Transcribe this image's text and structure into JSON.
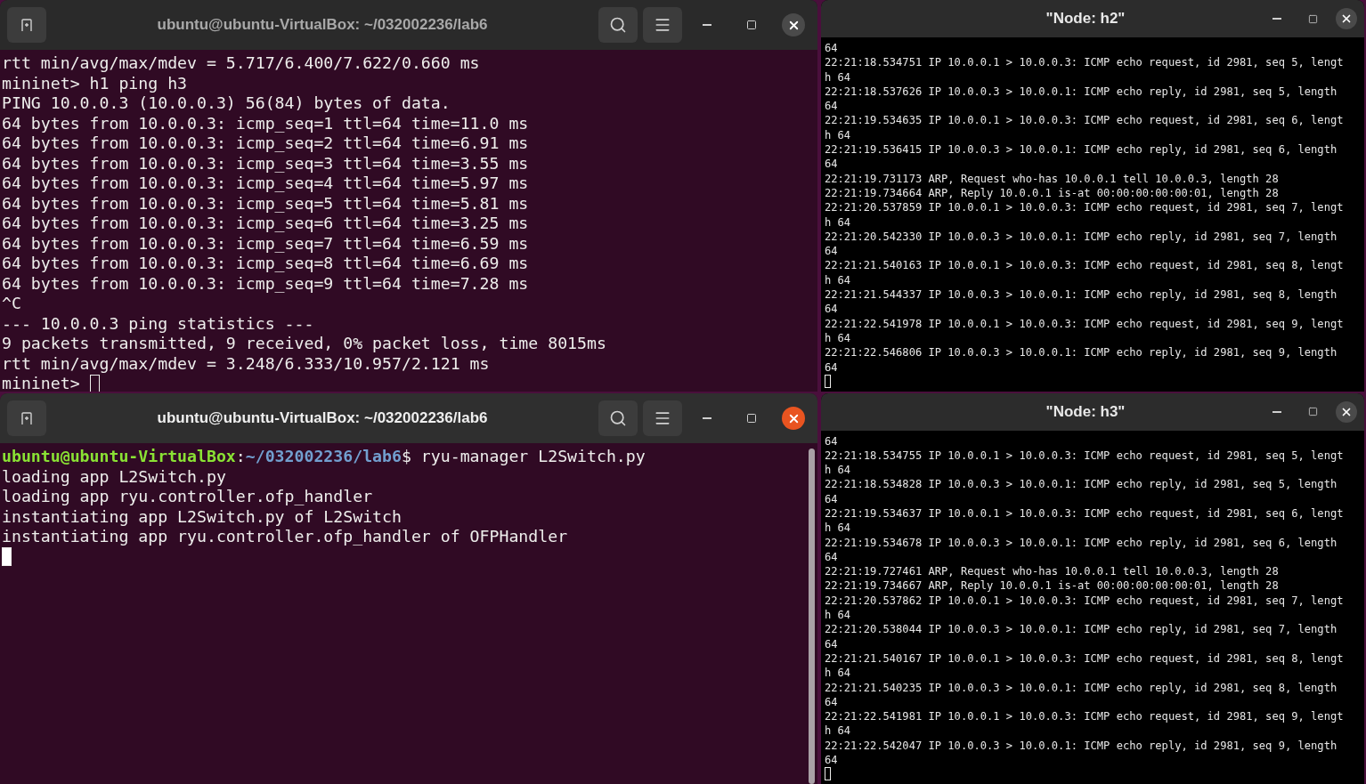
{
  "terminals": [
    {
      "title": "ubuntu@ubuntu-VirtualBox: ~/032002236/lab6",
      "focused": false,
      "lines": [
        {
          "kind": "output",
          "text": "rtt min/avg/max/mdev = 5.717/6.400/7.622/0.660 ms"
        },
        {
          "kind": "output",
          "text": "mininet> h1 ping h3"
        },
        {
          "kind": "output",
          "text": "PING 10.0.0.3 (10.0.0.3) 56(84) bytes of data."
        },
        {
          "kind": "output",
          "text": "64 bytes from 10.0.0.3: icmp_seq=1 ttl=64 time=11.0 ms"
        },
        {
          "kind": "output",
          "text": "64 bytes from 10.0.0.3: icmp_seq=2 ttl=64 time=6.91 ms"
        },
        {
          "kind": "output",
          "text": "64 bytes from 10.0.0.3: icmp_seq=3 ttl=64 time=3.55 ms"
        },
        {
          "kind": "output",
          "text": "64 bytes from 10.0.0.3: icmp_seq=4 ttl=64 time=5.97 ms"
        },
        {
          "kind": "output",
          "text": "64 bytes from 10.0.0.3: icmp_seq=5 ttl=64 time=5.81 ms"
        },
        {
          "kind": "output",
          "text": "64 bytes from 10.0.0.3: icmp_seq=6 ttl=64 time=3.25 ms"
        },
        {
          "kind": "output",
          "text": "64 bytes from 10.0.0.3: icmp_seq=7 ttl=64 time=6.59 ms"
        },
        {
          "kind": "output",
          "text": "64 bytes from 10.0.0.3: icmp_seq=8 ttl=64 time=6.69 ms"
        },
        {
          "kind": "output",
          "text": "64 bytes from 10.0.0.3: icmp_seq=9 ttl=64 time=7.28 ms"
        },
        {
          "kind": "output",
          "text": "^C"
        },
        {
          "kind": "output",
          "text": "--- 10.0.0.3 ping statistics ---"
        },
        {
          "kind": "output",
          "text": "9 packets transmitted, 9 received, 0% packet loss, time 8015ms"
        },
        {
          "kind": "output",
          "text": "rtt min/avg/max/mdev = 3.248/6.333/10.957/2.121 ms"
        },
        {
          "kind": "input",
          "text": "mininet>"
        }
      ]
    },
    {
      "title": "ubuntu@ubuntu-VirtualBox: ~/032002236/lab6",
      "focused": true,
      "lines": [
        {
          "kind": "prompt",
          "user": "ubuntu@ubuntu-VirtualBox",
          "sep": ":",
          "path": "~/032002236/lab6",
          "command": "$ ryu-manager L2Switch.py"
        },
        {
          "kind": "output",
          "text": "loading app L2Switch.py"
        },
        {
          "kind": "output",
          "text": "loading app ryu.controller.ofp_handler"
        },
        {
          "kind": "output",
          "text": "instantiating app L2Switch.py of L2Switch"
        },
        {
          "kind": "output",
          "text": "instantiating app ryu.controller.ofp_handler of OFPHandler"
        },
        {
          "kind": "cursor"
        }
      ]
    }
  ],
  "nodes": [
    {
      "title": "\"Node: h2\"",
      "focused": false,
      "lines": [
        "64",
        "22:21:18.534751 IP 10.0.0.1 > 10.0.0.3: ICMP echo request, id 2981, seq 5, lengt",
        "h 64",
        "22:21:18.537626 IP 10.0.0.3 > 10.0.0.1: ICMP echo reply, id 2981, seq 5, length",
        "64",
        "22:21:19.534635 IP 10.0.0.1 > 10.0.0.3: ICMP echo request, id 2981, seq 6, lengt",
        "h 64",
        "22:21:19.536415 IP 10.0.0.3 > 10.0.0.1: ICMP echo reply, id 2981, seq 6, length",
        "64",
        "22:21:19.731173 ARP, Request who-has 10.0.0.1 tell 10.0.0.3, length 28",
        "22:21:19.734664 ARP, Reply 10.0.0.1 is-at 00:00:00:00:00:01, length 28",
        "22:21:20.537859 IP 10.0.0.1 > 10.0.0.3: ICMP echo request, id 2981, seq 7, lengt",
        "h 64",
        "22:21:20.542330 IP 10.0.0.3 > 10.0.0.1: ICMP echo reply, id 2981, seq 7, length",
        "64",
        "22:21:21.540163 IP 10.0.0.1 > 10.0.0.3: ICMP echo request, id 2981, seq 8, lengt",
        "h 64",
        "22:21:21.544337 IP 10.0.0.3 > 10.0.0.1: ICMP echo reply, id 2981, seq 8, length",
        "64",
        "22:21:22.541978 IP 10.0.0.1 > 10.0.0.3: ICMP echo request, id 2981, seq 9, lengt",
        "h 64",
        "22:21:22.546806 IP 10.0.0.3 > 10.0.0.1: ICMP echo reply, id 2981, seq 9, length",
        "64"
      ]
    },
    {
      "title": "\"Node: h3\"",
      "focused": false,
      "lines": [
        "64",
        "22:21:18.534755 IP 10.0.0.1 > 10.0.0.3: ICMP echo request, id 2981, seq 5, lengt",
        "h 64",
        "22:21:18.534828 IP 10.0.0.3 > 10.0.0.1: ICMP echo reply, id 2981, seq 5, length",
        "64",
        "22:21:19.534637 IP 10.0.0.1 > 10.0.0.3: ICMP echo request, id 2981, seq 6, lengt",
        "h 64",
        "22:21:19.534678 IP 10.0.0.3 > 10.0.0.1: ICMP echo reply, id 2981, seq 6, length",
        "64",
        "22:21:19.727461 ARP, Request who-has 10.0.0.1 tell 10.0.0.3, length 28",
        "22:21:19.734667 ARP, Reply 10.0.0.1 is-at 00:00:00:00:00:01, length 28",
        "22:21:20.537862 IP 10.0.0.1 > 10.0.0.3: ICMP echo request, id 2981, seq 7, lengt",
        "h 64",
        "22:21:20.538044 IP 10.0.0.3 > 10.0.0.1: ICMP echo reply, id 2981, seq 7, length",
        "64",
        "22:21:21.540167 IP 10.0.0.1 > 10.0.0.3: ICMP echo request, id 2981, seq 8, lengt",
        "h 64",
        "22:21:21.540235 IP 10.0.0.3 > 10.0.0.1: ICMP echo reply, id 2981, seq 8, length",
        "64",
        "22:21:22.541981 IP 10.0.0.1 > 10.0.0.3: ICMP echo request, id 2981, seq 9, lengt",
        "h 64",
        "22:21:22.542047 IP 10.0.0.3 > 10.0.0.1: ICMP echo reply, id 2981, seq 9, length",
        "64"
      ]
    }
  ]
}
